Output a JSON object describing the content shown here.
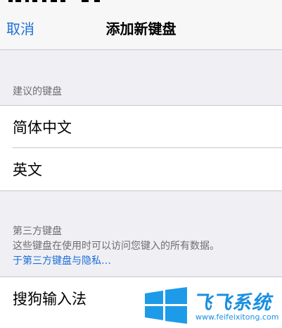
{
  "navbar": {
    "cancel_label": "取消",
    "title": "添加新键盘"
  },
  "suggested": {
    "header": "建议的键盘",
    "items": [
      {
        "label": "简体中文"
      },
      {
        "label": "英文"
      }
    ]
  },
  "third_party": {
    "header": "第三方键盘",
    "description": "这些键盘在使用时可以访问您键入的所有数据。",
    "privacy_link": "于第三方键盘与隐私…",
    "items": [
      {
        "label": "搜狗输入法"
      }
    ]
  },
  "watermark": {
    "brand": "飞飞系统",
    "url": "www.feifeixitong.com",
    "logo_icon": "windows-logo-icon",
    "colors": {
      "brand": "#1a8fe0",
      "logo": "#1e9be8"
    }
  },
  "colors": {
    "accent": "#1d6fd6",
    "background": "#efeff4",
    "section_header": "#6d6d72",
    "separator": "#c8c7cc"
  }
}
